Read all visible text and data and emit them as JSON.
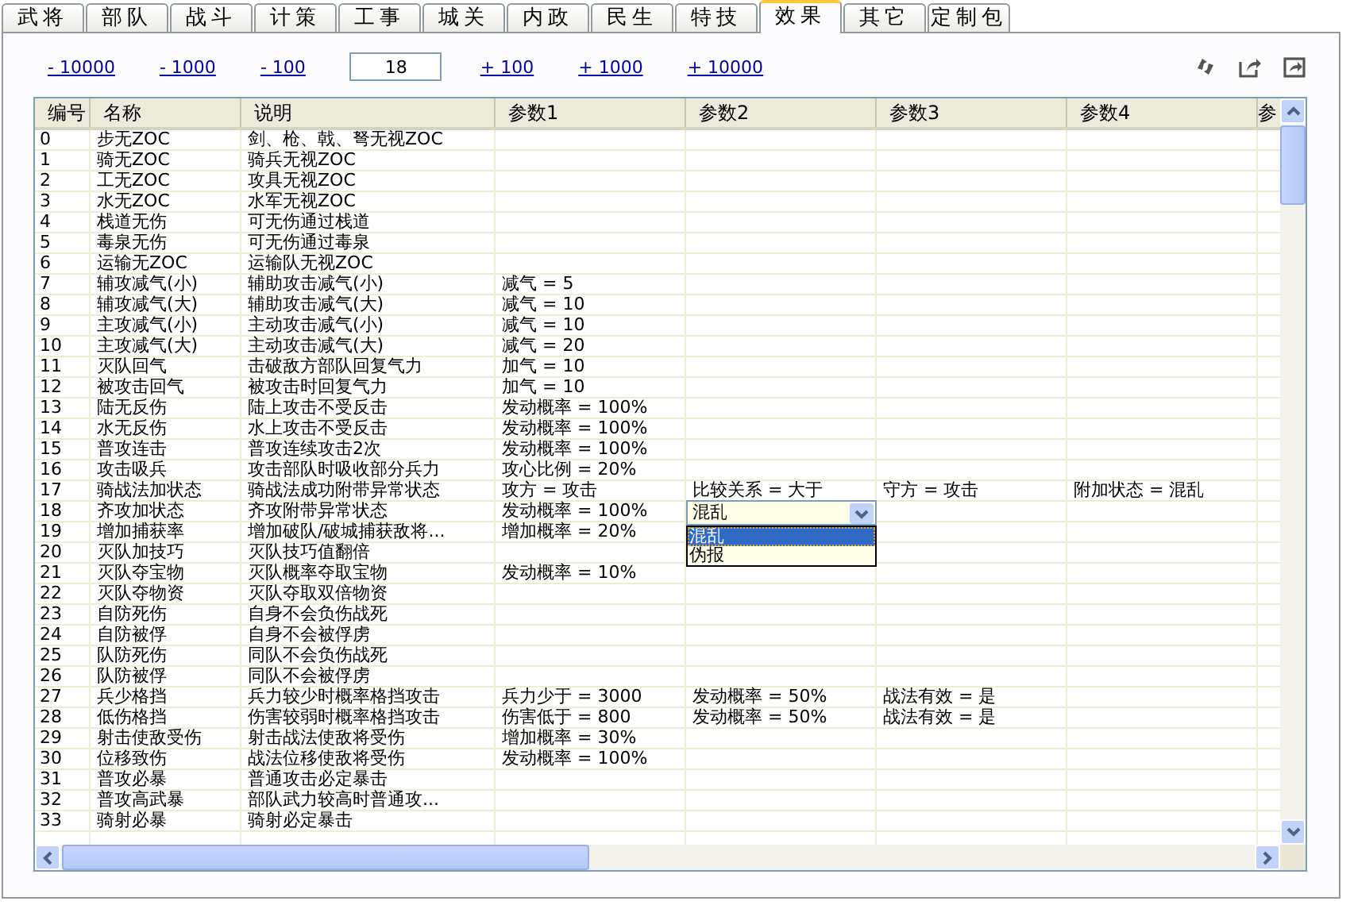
{
  "tabs": [
    {
      "label": "武将",
      "selected": false
    },
    {
      "label": "部队",
      "selected": false
    },
    {
      "label": "战斗",
      "selected": false
    },
    {
      "label": "计策",
      "selected": false
    },
    {
      "label": "工事",
      "selected": false
    },
    {
      "label": "城关",
      "selected": false
    },
    {
      "label": "内政",
      "selected": false
    },
    {
      "label": "民生",
      "selected": false
    },
    {
      "label": "特技",
      "selected": false
    },
    {
      "label": "效果",
      "selected": true
    },
    {
      "label": "其它",
      "selected": false
    },
    {
      "label": "定制包",
      "selected": false
    }
  ],
  "stepper": {
    "decrease": [
      "- 10000",
      "- 1000",
      "- 100"
    ],
    "value": "18",
    "increase": [
      "+ 100",
      "+ 1000",
      "+ 10000"
    ]
  },
  "table": {
    "columns": [
      "编号",
      "名称",
      "说明",
      "参数1",
      "参数2",
      "参数3",
      "参数4",
      "参"
    ],
    "rows": [
      {
        "id": "0",
        "name": "步无ZOC",
        "desc": "剑、枪、戟、弩无视ZOC",
        "params": []
      },
      {
        "id": "1",
        "name": "骑无ZOC",
        "desc": "骑兵无视ZOC",
        "params": []
      },
      {
        "id": "2",
        "name": "工无ZOC",
        "desc": "攻具无视ZOC",
        "params": []
      },
      {
        "id": "3",
        "name": "水无ZOC",
        "desc": "水军无视ZOC",
        "params": []
      },
      {
        "id": "4",
        "name": "栈道无伤",
        "desc": "可无伤通过栈道",
        "params": []
      },
      {
        "id": "5",
        "name": "毒泉无伤",
        "desc": "可无伤通过毒泉",
        "params": []
      },
      {
        "id": "6",
        "name": "运输无ZOC",
        "desc": "运输队无视ZOC",
        "params": []
      },
      {
        "id": "7",
        "name": "辅攻减气(小)",
        "desc": "辅助攻击减气(小)",
        "params": [
          "减气 = 5"
        ]
      },
      {
        "id": "8",
        "name": "辅攻减气(大)",
        "desc": "辅助攻击减气(大)",
        "params": [
          "减气 = 10"
        ]
      },
      {
        "id": "9",
        "name": "主攻减气(小)",
        "desc": "主动攻击减气(小)",
        "params": [
          "减气 = 10"
        ]
      },
      {
        "id": "10",
        "name": "主攻减气(大)",
        "desc": "主动攻击减气(大)",
        "params": [
          "减气 = 20"
        ]
      },
      {
        "id": "11",
        "name": "灭队回气",
        "desc": "击破敌方部队回复气力",
        "params": [
          "加气 = 10"
        ]
      },
      {
        "id": "12",
        "name": "被攻击回气",
        "desc": "被攻击时回复气力",
        "params": [
          "加气 = 10"
        ]
      },
      {
        "id": "13",
        "name": "陆无反伤",
        "desc": "陆上攻击不受反击",
        "params": [
          "发动概率 = 100%"
        ]
      },
      {
        "id": "14",
        "name": "水无反伤",
        "desc": "水上攻击不受反击",
        "params": [
          "发动概率 = 100%"
        ]
      },
      {
        "id": "15",
        "name": "普攻连击",
        "desc": "普攻连续攻击2次",
        "params": [
          "发动概率 = 100%"
        ]
      },
      {
        "id": "16",
        "name": "攻击吸兵",
        "desc": "攻击部队时吸收部分兵力",
        "params": [
          "攻心比例 = 20%"
        ]
      },
      {
        "id": "17",
        "name": "骑战法加状态",
        "desc": "骑战法成功附带异常状态",
        "params": [
          "攻方 = 攻击",
          "比较关系 = 大于",
          "守方 = 攻击",
          "附加状态 = 混乱"
        ]
      },
      {
        "id": "18",
        "name": "齐攻加状态",
        "desc": "齐攻附带异常状态",
        "params": [
          "发动概率 = 100%"
        ],
        "editor": {
          "value": "混乱",
          "options": [
            {
              "label": "混乱",
              "selected": true
            },
            {
              "label": "伪报",
              "selected": false
            }
          ]
        }
      },
      {
        "id": "19",
        "name": "增加捕获率",
        "desc": "增加破队/破城捕获敌将...",
        "params": [
          "增加概率 = 20%"
        ]
      },
      {
        "id": "20",
        "name": "灭队加技巧",
        "desc": "灭队技巧值翻倍",
        "params": []
      },
      {
        "id": "21",
        "name": "灭队夺宝物",
        "desc": "灭队概率夺取宝物",
        "params": [
          "发动概率 = 10%"
        ]
      },
      {
        "id": "22",
        "name": "灭队夺物资",
        "desc": "灭队夺取双倍物资",
        "params": []
      },
      {
        "id": "23",
        "name": "自防死伤",
        "desc": "自身不会负伤战死",
        "params": []
      },
      {
        "id": "24",
        "name": "自防被俘",
        "desc": "自身不会被俘虏",
        "params": []
      },
      {
        "id": "25",
        "name": "队防死伤",
        "desc": "同队不会负伤战死",
        "params": []
      },
      {
        "id": "26",
        "name": "队防被俘",
        "desc": "同队不会被俘虏",
        "params": []
      },
      {
        "id": "27",
        "name": "兵少格挡",
        "desc": "兵力较少时概率格挡攻击",
        "params": [
          "兵力少于 = 3000",
          "发动概率 = 50%",
          "战法有效 = 是"
        ]
      },
      {
        "id": "28",
        "name": "低伤格挡",
        "desc": "伤害较弱时概率格挡攻击",
        "params": [
          "伤害低于 = 800",
          "发动概率 = 50%",
          "战法有效 = 是"
        ]
      },
      {
        "id": "29",
        "name": "射击使敌受伤",
        "desc": "射击战法使敌将受伤",
        "params": [
          "增加概率 = 30%"
        ]
      },
      {
        "id": "30",
        "name": "位移致伤",
        "desc": "战法位移使敌将受伤",
        "params": [
          "发动概率 = 100%"
        ]
      },
      {
        "id": "31",
        "name": "普攻必暴",
        "desc": "普通攻击必定暴击",
        "params": []
      },
      {
        "id": "32",
        "name": "普攻高武暴",
        "desc": "部队武力较高时普通攻...",
        "params": []
      },
      {
        "id": "33",
        "name": "骑射必暴",
        "desc": "骑射必定暴击",
        "params": []
      }
    ]
  }
}
